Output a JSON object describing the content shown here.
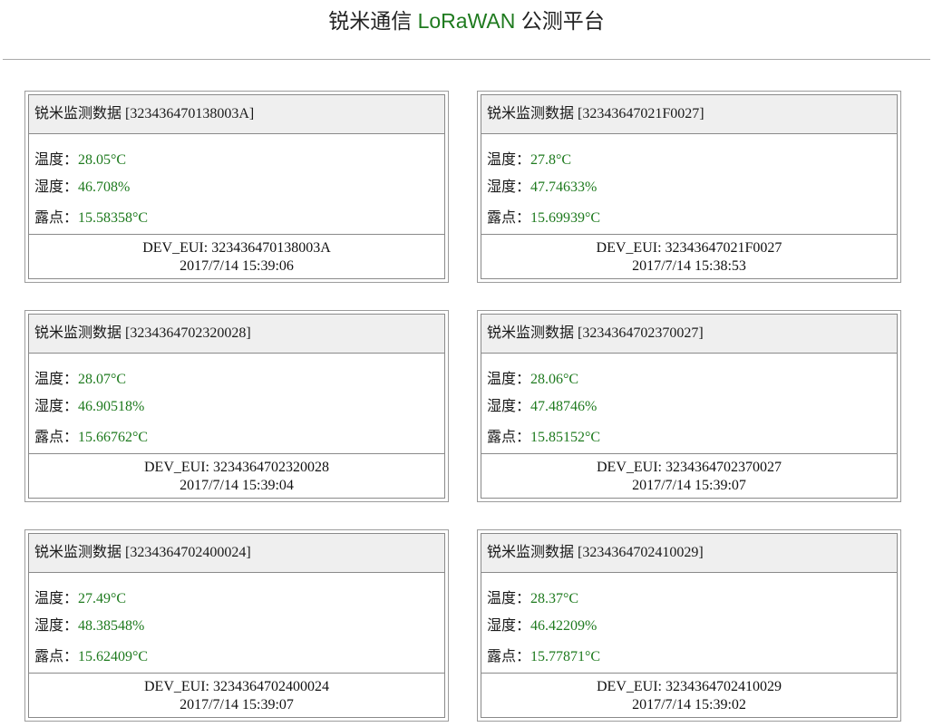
{
  "header": {
    "prefix": "锐米通信 ",
    "accent": "LoRaWAN",
    "suffix": " 公测平台",
    "accent_color": "#1e7a1e"
  },
  "labels": {
    "temperature": "温度：",
    "humidity": "湿度：",
    "dew_point": "露点："
  },
  "cards": [
    {
      "title": "锐米监测数据 [323436470138003A]",
      "temperature": "28.05°C",
      "humidity": "46.708%",
      "dew_point": "15.58358°C",
      "dev_eui": "DEV_EUI: 323436470138003A",
      "timestamp": "2017/7/14 15:39:06"
    },
    {
      "title": "锐米监测数据 [32343647021F0027]",
      "temperature": "27.8°C",
      "humidity": "47.74633%",
      "dew_point": "15.69939°C",
      "dev_eui": "DEV_EUI: 32343647021F0027",
      "timestamp": "2017/7/14 15:38:53"
    },
    {
      "title": "锐米监测数据 [3234364702320028]",
      "temperature": "28.07°C",
      "humidity": "46.90518%",
      "dew_point": "15.66762°C",
      "dev_eui": "DEV_EUI: 3234364702320028",
      "timestamp": "2017/7/14 15:39:04"
    },
    {
      "title": "锐米监测数据 [3234364702370027]",
      "temperature": "28.06°C",
      "humidity": "47.48746%",
      "dew_point": "15.85152°C",
      "dev_eui": "DEV_EUI: 3234364702370027",
      "timestamp": "2017/7/14 15:39:07"
    },
    {
      "title": "锐米监测数据 [3234364702400024]",
      "temperature": "27.49°C",
      "humidity": "48.38548%",
      "dew_point": "15.62409°C",
      "dev_eui": "DEV_EUI: 3234364702400024",
      "timestamp": "2017/7/14 15:39:07"
    },
    {
      "title": "锐米监测数据 [3234364702410029]",
      "temperature": "28.37°C",
      "humidity": "46.42209%",
      "dew_point": "15.77871°C",
      "dev_eui": "DEV_EUI: 3234364702410029",
      "timestamp": "2017/7/14 15:39:02"
    }
  ]
}
